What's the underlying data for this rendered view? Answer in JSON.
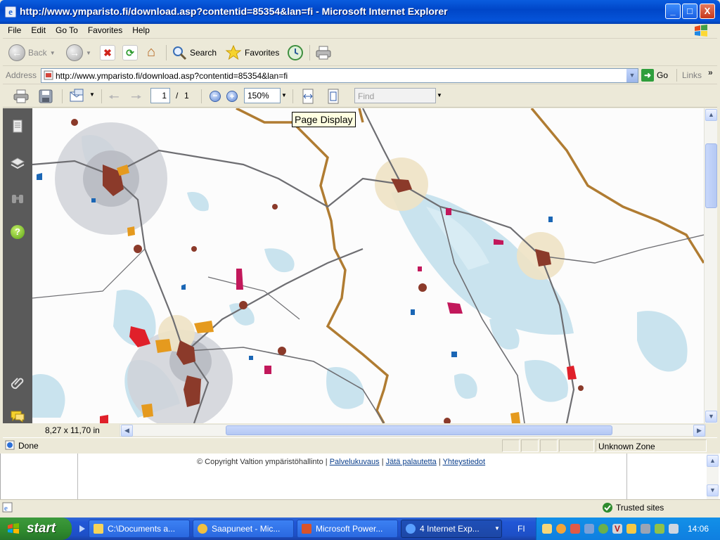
{
  "window": {
    "title": "http://www.ymparisto.fi/download.asp?contentid=85354&lan=fi - Microsoft Internet Explorer",
    "minimize": "_",
    "maximize": "□",
    "close": "X"
  },
  "menu": [
    "File",
    "Edit",
    "Go To",
    "Favorites",
    "Help"
  ],
  "toolbar": {
    "back": "Back",
    "search": "Search",
    "favorites": "Favorites"
  },
  "address": {
    "label": "Address",
    "url": "http://www.ymparisto.fi/download.asp?contentid=85354&lan=fi",
    "go": "Go",
    "links": "Links"
  },
  "pdf": {
    "page": "1",
    "page_sep": "/",
    "page_total": "1",
    "zoom": "150%",
    "find_placeholder": "Find",
    "tooltip": "Page Display",
    "page_size": "8,27 x 11,70 in"
  },
  "status": {
    "text": "Done",
    "zone": "Unknown Zone",
    "trusted": "Trusted sites"
  },
  "footer": {
    "copyright": "© Copyright Valtion ympäristöhallinto  |",
    "links": [
      "Palvelukuvaus",
      "Jätä palautetta",
      "Yhteystiedot"
    ],
    "sep": "|"
  },
  "taskbar": {
    "start": "start",
    "tasks": [
      "C:\\Documents a...",
      "Saapuneet - Mic...",
      "Microsoft Power...",
      "4 Internet Exp..."
    ],
    "lang": "FI",
    "clock": "14:06"
  },
  "colors": {
    "accent": "#0054e3",
    "lake": "#c9e3ee",
    "road": "#6e6e72",
    "boundary": "#b07c32",
    "town": "#8b3a2a",
    "orange_zone": "#e59a1e",
    "red_zone": "#e0202a",
    "magenta_zone": "#c2185b",
    "blue_zone": "#1a66b5"
  }
}
